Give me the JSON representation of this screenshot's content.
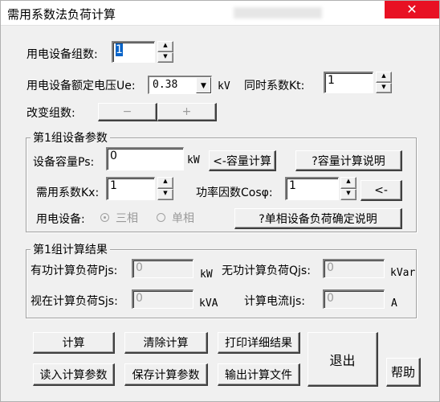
{
  "window": {
    "title": "需用系数法负荷计算",
    "close_glyph": "✕"
  },
  "top": {
    "group_count_label": "用电设备组数:",
    "group_count_value": "1",
    "rated_voltage_label": "用电设备额定电压Ue:",
    "rated_voltage_value": "0.38",
    "rated_voltage_unit": "kV",
    "simult_label": "同时系数Kt:",
    "simult_value": "1",
    "change_groups_label": "改变组数:",
    "minus_label": "−",
    "plus_label": "+"
  },
  "params": {
    "title": "第1组设备参数",
    "capacity_label": "设备容量Ps:",
    "capacity_value": "0",
    "capacity_unit": "kW",
    "capacity_calc_button": "<-容量计算",
    "capacity_help_button": "?容量计算说明",
    "kx_label": "需用系数Kx:",
    "kx_value": "1",
    "cos_label": "功率因数Cosφ:",
    "cos_value": "1",
    "cos_button": "<-",
    "equipment_label": "用电设备:",
    "three_phase_label": "三相",
    "single_phase_label": "单相",
    "single_phase_help_button": "?单相设备负荷确定说明"
  },
  "results": {
    "title": "第1组计算结果",
    "pjs_label": "有功计算负荷Pjs:",
    "pjs_value": "0",
    "pjs_unit": "kW",
    "qjs_label": "无功计算负荷Qjs:",
    "qjs_value": "0",
    "qjs_unit": "kVar",
    "sjs_label": "视在计算负荷Sjs:",
    "sjs_value": "0",
    "sjs_unit": "kVA",
    "ijs_label": "计算电流Ijs:",
    "ijs_value": "0",
    "ijs_unit": "A"
  },
  "buttons": {
    "calculate": "计算",
    "clear": "清除计算",
    "print": "打印详细结果",
    "exit": "退出",
    "read_params": "读入计算参数",
    "save_params": "保存计算参数",
    "export": "输出计算文件",
    "help": "帮助"
  }
}
